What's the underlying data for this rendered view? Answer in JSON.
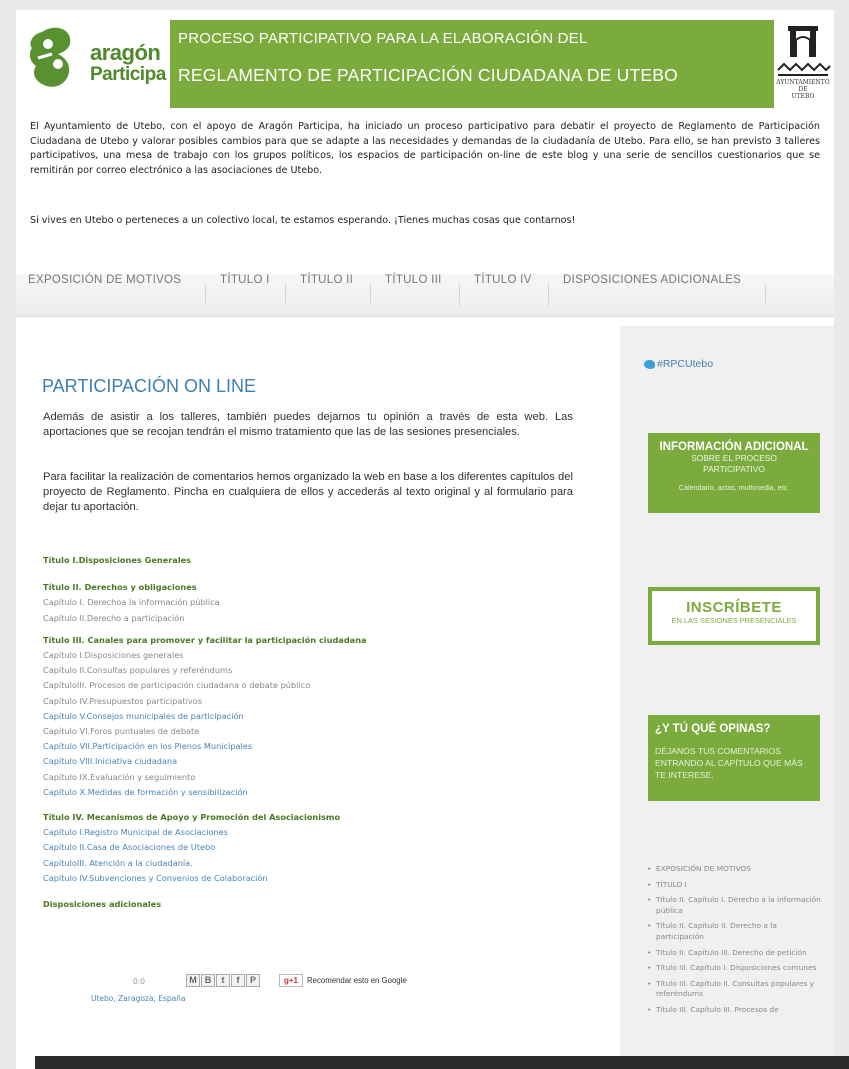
{
  "header": {
    "logo_line1": "aragón",
    "logo_line2": "Participa",
    "banner_line1": "PROCESO PARTICIPATIVO PARA LA ELABORACIÓN DEL",
    "banner_line2": "REGLAMENTO DE PARTICIPACIÓN CIUDADANA DE UTEBO",
    "ayto_caption_1": "AYUNTAMIENTO",
    "ayto_caption_2": "DE",
    "ayto_caption_3": "UTEBO"
  },
  "intro": {
    "p1": "El Ayuntamiento de Utebo, con el apoyo de Aragón Participa, ha iniciado un proceso participativo para debatir el proyecto de Reglamento de Participación Ciudadana de Utebo y valorar posibles cambios para que se adapte a las necesidades y demandas de la ciudadanía de Utebo. Para ello, se han previsto 3 talleres participativos, una mesa de trabajo con los grupos políticos, los espacios de participación on-line de este blog y una serie de sencillos cuestionarios que se remitirán por correo electrónico a las asociaciones de Utebo.",
    "p2": "Si vives en Utebo o perteneces a un colectivo local, te estamos esperando. ¡Tienes muchas cosas que contarnos!"
  },
  "nav": {
    "items": [
      "EXPOSICIÓN DE MOTIVOS",
      "TÍTULO I",
      "TÍTULO II",
      "TÍTULO III",
      "TÍTULO IV",
      "DISPOSICIONES ADICIONALES"
    ]
  },
  "main": {
    "title": "PARTICIPACIÓN ON LINE",
    "para1": "Además de asistir a los talleres, también puedes dejarnos tu opinión a través de esta web. Las aportaciones que se recojan tendrán el mismo tratamiento que las de las sesiones presenciales.",
    "para2": "Para facilitar la realización de comentarios hemos organizado la web en base a los diferentes capítulos del proyecto de Reglamento. Pincha en cualquiera de ellos y accederás al texto original y al formulario para dejar tu aportación.",
    "toc": {
      "t1": "Título I.Disposiciones Generales",
      "t2": "Título II. Derechos y obligaciones",
      "t2c1": "Capítulo I. Derechoa la información pública",
      "t2c2": "Capítulo II.Derecho a participación",
      "t3": "Título III. Canales para promover y facilitar la participación ciudadana",
      "t3c1": "Capítulo I.Disposiciones generales",
      "t3c2": "Capítulo II.Consultas populares y referéndums",
      "t3c3": "CapítuloIII. Procesos de participación ciudadana o debate público",
      "t3c4": "Capítulo IV.Presupuestos participativos",
      "t3c5": "Capítulo V.Consejos municipales de participación",
      "t3c6": "Capítulo VI.Foros puntuales de debate",
      "t3c7": "Capítulo VII.Participación en los Plenos Municipales",
      "t3c8": "Capítulo VIII.Iniciativa ciudadana",
      "t3c9": "Capítulo IX.Evaluación y seguimiento",
      "t3c10": "Capítulo X.Medidas de formación y sensibilización",
      "t4": "Título IV. Mecanismos de Apoyo y Promoción del Asociacionismo",
      "t4c1": "Capítulo I.Registro Municipal de Asociaciones",
      "t4c2": "Capítulo II.Casa de Asociaciones de Utebo",
      "t4c3": "CapítuloIII. Atención a la ciudadanía.",
      "t4c4": "Capítulo IV.Subvenciones y Convenios de Colaboración",
      "t5": "Disposiciones adicionales"
    },
    "share_label": "0:0",
    "share_icons": [
      "M",
      "B",
      "t",
      "f",
      "P"
    ],
    "gplus": "g+1",
    "recommend": "Recomendar esto en Google",
    "location": "Utebo, Zaragoza, España"
  },
  "sidebar": {
    "twitter": "#RPCUtebo",
    "box1_title": "INFORMACIÓN ADICIONAL",
    "box1_sub1": "SOBRE EL PROCESO",
    "box1_sub2": "PARTICIPATIVO",
    "box1_caption": "Calendario, actas, multimedia, etc.",
    "box2_title": "INSCRÍBETE",
    "box2_sub": "EN LAS SESIONES PRESENCIALES",
    "box3_title": "¿Y TÚ QUÉ OPINAS?",
    "box3_text": "DÉJANOS TUS COMENTARIOS ENTRANDO AL CAPÍTULO QUE MÁS TE INTERESE.",
    "links": [
      "EXPOSICIÓN DE MOTIVOS",
      "TÍTULO I",
      "Título II. Capítulo I. Derecho a la información pública",
      "Título II. Capítulo II. Derecho a la participación",
      "Título II. Capítulo III. Derecho de petición",
      "Título III. Capítulo I. Disposiciones comunes",
      "Título III. Capítulo II. Consultas populares y referéndums",
      "Título III. Capítulo III. Procesos de"
    ]
  },
  "colors": {
    "brand_green": "#7aab3c",
    "link_blue": "#3f7fb3",
    "section_green": "#4a7a25"
  }
}
